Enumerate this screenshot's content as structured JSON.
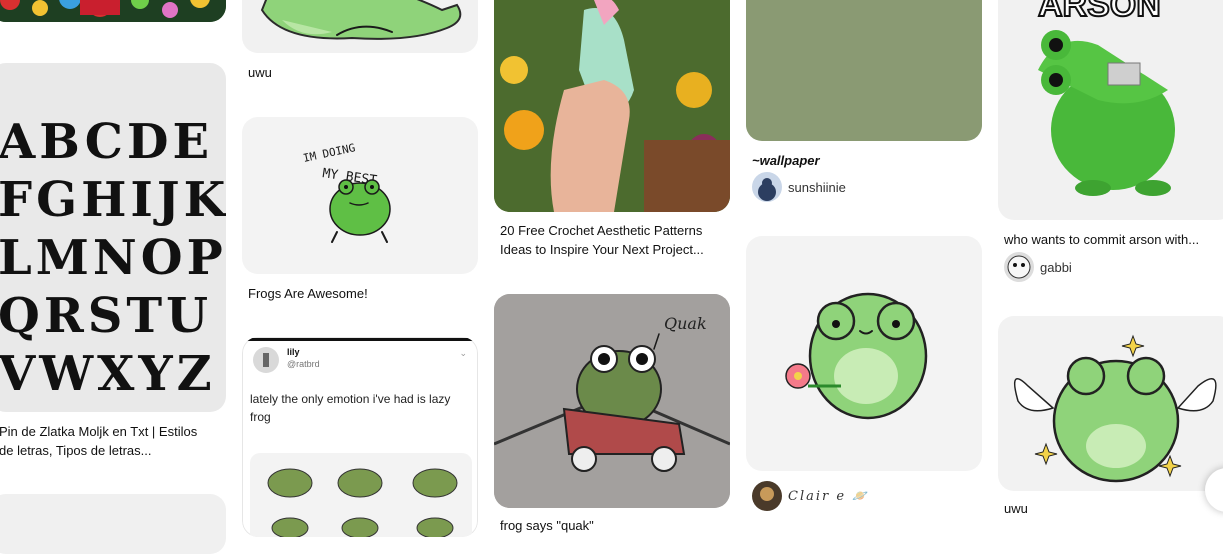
{
  "pins": {
    "uwu_frog": {
      "title": "uwu"
    },
    "frogs_awesome": {
      "title": "Frogs Are Awesome!",
      "art_text": "IM DOING MY BEST"
    },
    "font_pin": {
      "title_line1": "Pin de Zlatka Moljk en Txt | Estilos",
      "title_line2": "de letras, Tipos de letras...",
      "rows": [
        "ABCDE",
        "FGHIJK",
        "LMNOP",
        "QRSTU",
        "VWXYZ"
      ]
    },
    "tweet_pin": {
      "display_name": "lily",
      "handle": "@ratbrd",
      "text": "lately the only emotion i've had is lazy frog"
    },
    "crochet": {
      "title_line1": "20 Free Crochet Aesthetic Patterns",
      "title_line2": "Ideas to Inspire Your Next Project..."
    },
    "quak": {
      "title": "frog says \"quak\"",
      "art_text": "Quak"
    },
    "wallpaper": {
      "title": "~wallpaper",
      "creator": "sunshiinie"
    },
    "claire": {
      "creator": "Clair e"
    },
    "arson": {
      "art_text": "ARSON",
      "title": "who wants to commit arson with...",
      "creator": "gabbi"
    },
    "angel_frog": {
      "title": "uwu"
    }
  },
  "colors": {
    "frog_green": "#8fd37a",
    "wallpaper_green": "#8a9a73",
    "toy_green": "#49b83a"
  }
}
